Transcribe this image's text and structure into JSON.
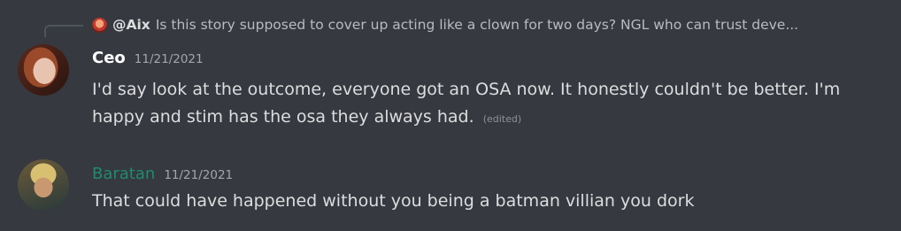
{
  "reply": {
    "author": "@Aix",
    "text": "Is this story supposed to cover up acting like a clown for two days? NGL who can trust deve..."
  },
  "messages": [
    {
      "author": "Ceo",
      "timestamp": "11/21/2021",
      "text": "I'd say look at the outcome, everyone got an OSA now. It honestly couldn't be better. I'm happy and stim has the osa they always had.",
      "edited": "(edited)",
      "author_color": "#ffffff"
    },
    {
      "author": "Baratan",
      "timestamp": "11/21/2021",
      "text": "That could have happened without you being a batman villian you dork",
      "author_color": "#1f8b6d"
    }
  ],
  "colors": {
    "background": "#36393f",
    "text": "#dcddde",
    "muted": "#a3a6aa"
  }
}
